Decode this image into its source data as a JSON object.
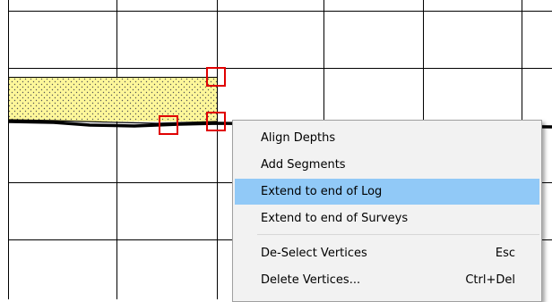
{
  "canvas": {
    "band_fill_color": "#fdf79a",
    "vertex_marker_color": "#e00000",
    "gridline_color": "#000000"
  },
  "context_menu": {
    "highlight_color": "#91c9f7",
    "items": [
      {
        "label": "Align Depths",
        "shortcut": ""
      },
      {
        "label": "Add Segments",
        "shortcut": ""
      },
      {
        "label": "Extend to end of Log",
        "shortcut": "",
        "highlighted": true
      },
      {
        "label": "Extend to end of Surveys",
        "shortcut": ""
      },
      {
        "label": "De-Select Vertices",
        "shortcut": "Esc"
      },
      {
        "label": "Delete Vertices...",
        "shortcut": "Ctrl+Del"
      }
    ]
  }
}
